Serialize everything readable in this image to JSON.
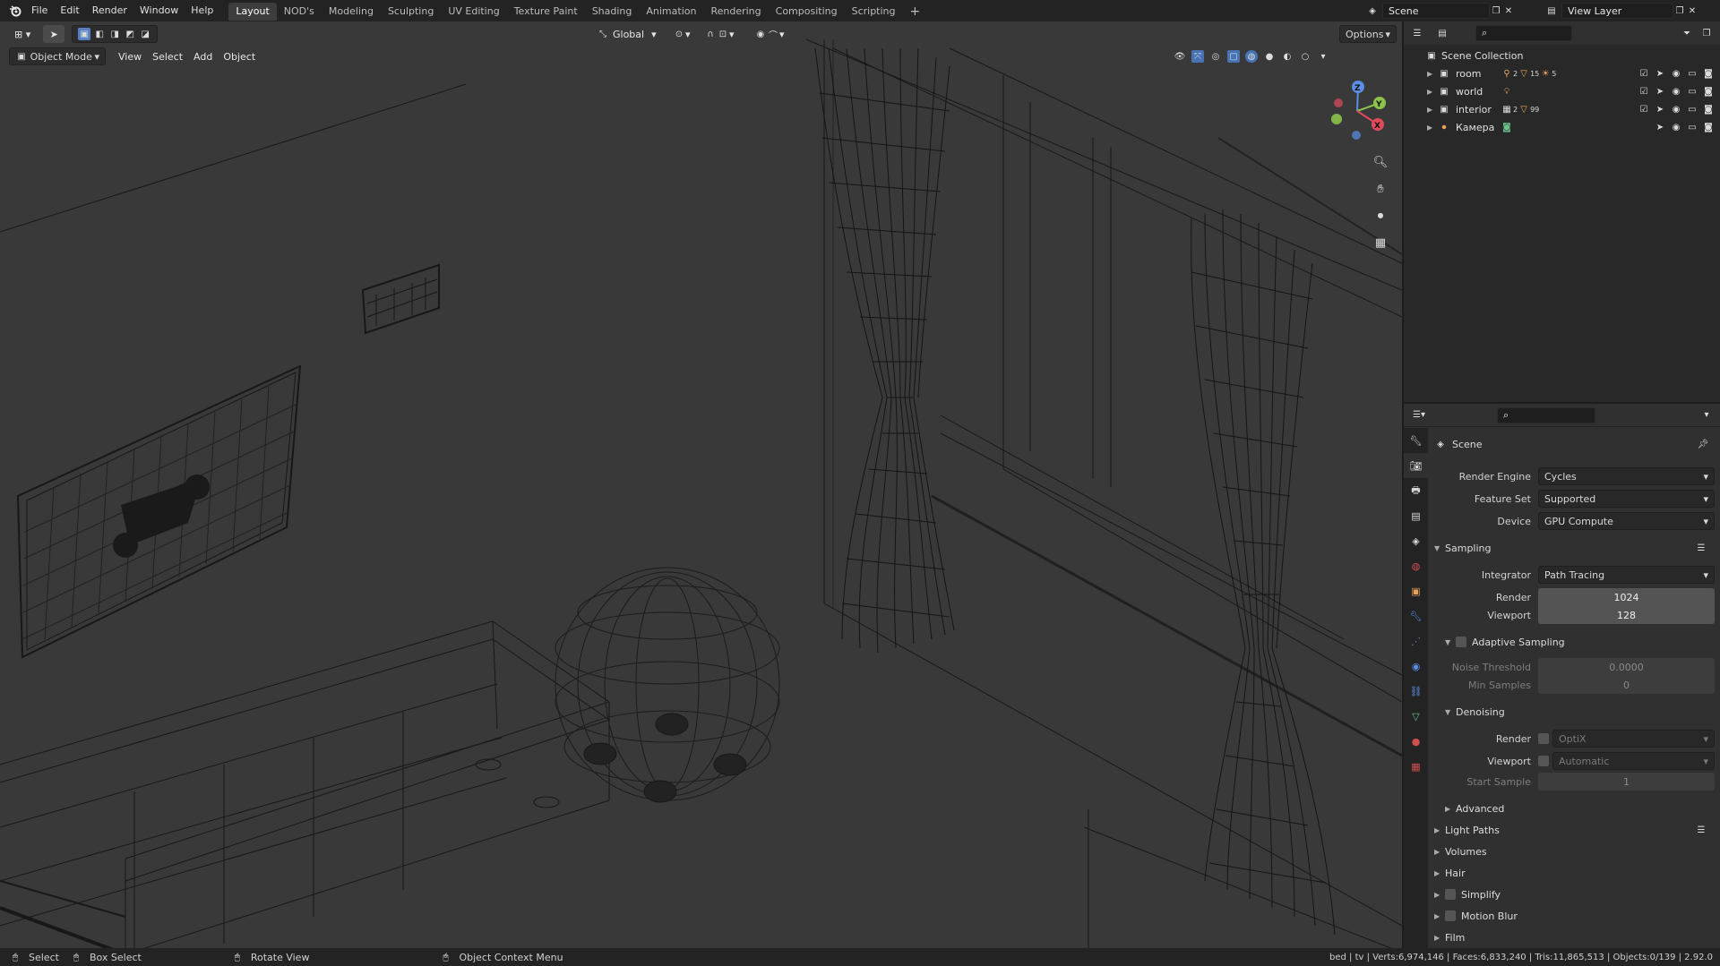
{
  "topbar": {
    "menus": [
      "File",
      "Edit",
      "Render",
      "Window",
      "Help"
    ],
    "workspaces": [
      "Layout",
      "NOD's",
      "Modeling",
      "Sculpting",
      "UV Editing",
      "Texture Paint",
      "Shading",
      "Animation",
      "Rendering",
      "Compositing",
      "Scripting"
    ],
    "active_workspace": "Layout",
    "add_tab": "+",
    "scene_name": "Scene",
    "view_layer": "View Layer"
  },
  "viewport": {
    "mode": "Object Mode",
    "menus": [
      "View",
      "Select",
      "Add",
      "Object"
    ],
    "orientation": "Global",
    "options": "Options",
    "gizmo": {
      "z": "Z",
      "y": "Y",
      "x": "X"
    }
  },
  "outliner": {
    "root": "Scene Collection",
    "items": [
      {
        "name": "room",
        "badge1": "2",
        "badge2": "15",
        "badge3": "5"
      },
      {
        "name": "world",
        "badge1": "",
        "badge2": "",
        "badge3": ""
      },
      {
        "name": "interior",
        "badge1": "2",
        "badge2": "99",
        "badge3": ""
      },
      {
        "name": "Камера",
        "badge1": "",
        "badge2": "",
        "badge3": ""
      }
    ]
  },
  "properties": {
    "context": "Scene",
    "render_engine": {
      "label": "Render Engine",
      "value": "Cycles"
    },
    "feature_set": {
      "label": "Feature Set",
      "value": "Supported"
    },
    "device": {
      "label": "Device",
      "value": "GPU Compute"
    },
    "sampling": {
      "title": "Sampling",
      "integrator": {
        "label": "Integrator",
        "value": "Path Tracing"
      },
      "render": {
        "label": "Render",
        "value": "1024"
      },
      "viewport": {
        "label": "Viewport",
        "value": "128"
      }
    },
    "adaptive": {
      "title": "Adaptive Sampling",
      "noise_threshold": {
        "label": "Noise Threshold",
        "value": "0.0000"
      },
      "min_samples": {
        "label": "Min Samples",
        "value": "0"
      }
    },
    "denoising": {
      "title": "Denoising",
      "render": {
        "label": "Render",
        "value": "OptiX"
      },
      "viewport": {
        "label": "Viewport",
        "value": "Automatic"
      },
      "start_sample": {
        "label": "Start Sample",
        "value": "1"
      }
    },
    "advanced": "Advanced",
    "panels": [
      "Light Paths",
      "Volumes",
      "Hair",
      "Simplify",
      "Motion Blur",
      "Film"
    ]
  },
  "statusbar": {
    "select": "Select",
    "box_select": "Box Select",
    "rotate": "Rotate View",
    "context_menu": "Object Context Menu",
    "stats": "bed | tv | Verts:6,974,146 | Faces:6,833,240 | Tris:11,865,513 | Objects:0/139 | 2.92.0"
  }
}
